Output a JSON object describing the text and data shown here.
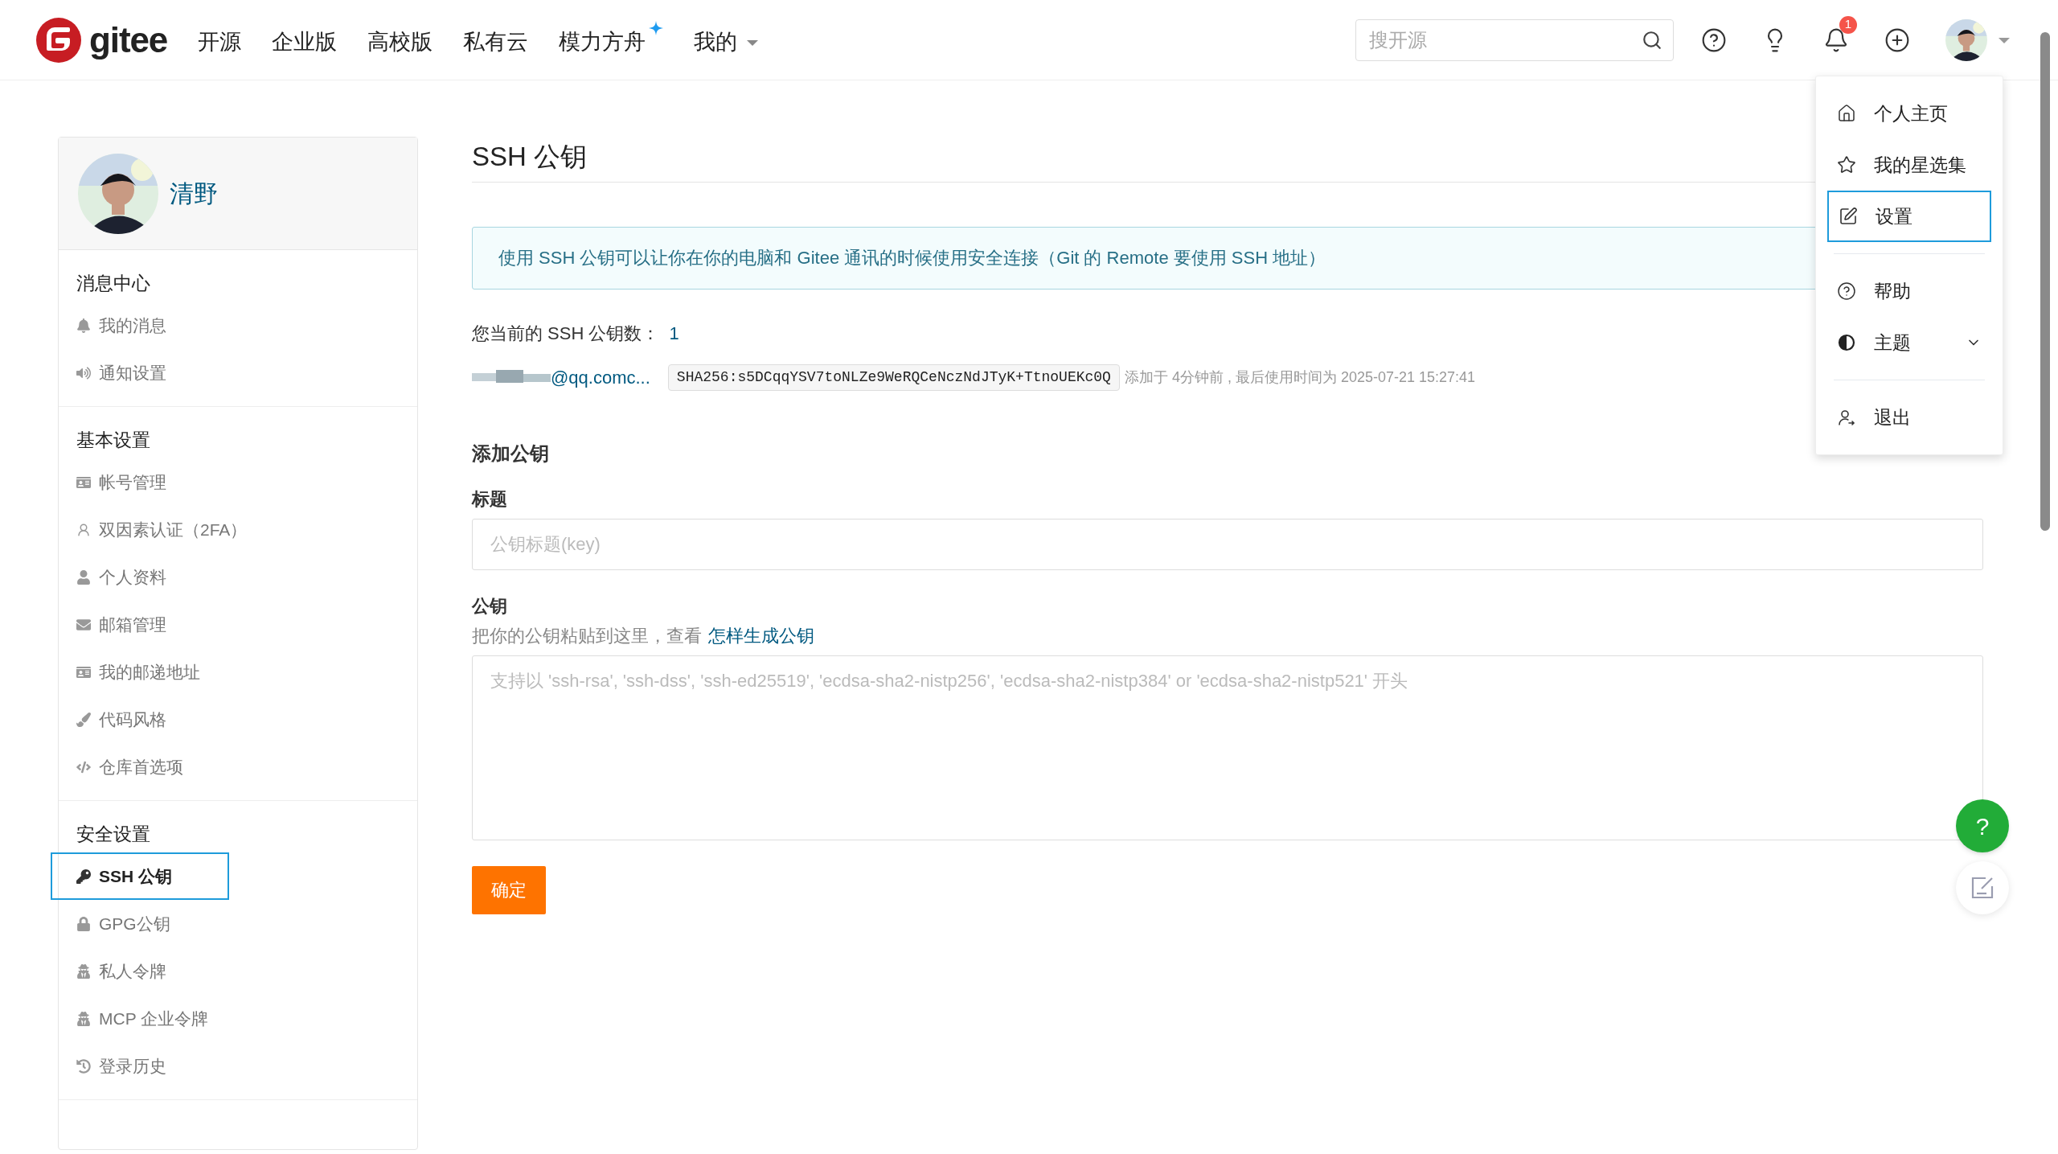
{
  "header": {
    "logo": "gitee",
    "nav": [
      {
        "label": "开源"
      },
      {
        "label": "企业版"
      },
      {
        "label": "高校版"
      },
      {
        "label": "私有云"
      },
      {
        "label": "模力方舟",
        "kind": "sparkle"
      },
      {
        "label": "我的",
        "kind": "menu"
      }
    ],
    "search": {
      "placeholder": "搜开源"
    },
    "notification_count": "1"
  },
  "profile": {
    "name": "清野"
  },
  "sidebar": [
    {
      "title": "消息中心",
      "items": [
        {
          "label": "我的消息",
          "selected": false
        },
        {
          "label": "通知设置",
          "selected": false
        }
      ]
    },
    {
      "title": "基本设置",
      "items": [
        {
          "label": "帐号管理",
          "selected": false
        },
        {
          "label": "双因素认证（2FA）",
          "selected": false
        },
        {
          "label": "个人资料",
          "selected": false
        },
        {
          "label": "邮箱管理",
          "selected": false
        },
        {
          "label": "我的邮递地址",
          "selected": false
        },
        {
          "label": "代码风格",
          "selected": false
        },
        {
          "label": "仓库首选项",
          "selected": false
        }
      ]
    },
    {
      "title": "安全设置",
      "items": [
        {
          "label": "SSH 公钥",
          "selected": true
        },
        {
          "label": "GPG公钥",
          "selected": false
        },
        {
          "label": "私人令牌",
          "selected": false
        },
        {
          "label": "MCP 企业令牌",
          "selected": false
        },
        {
          "label": "登录历史",
          "selected": false
        }
      ]
    }
  ],
  "page": {
    "title": "SSH 公钥",
    "info": "使用 SSH 公钥可以让你在你的电脑和 Gitee 通讯的时候使用安全连接（Git 的 Remote 要使用 SSH 地址）",
    "count_label": "您当前的 SSH 公钥数：",
    "count": "1",
    "keys": [
      {
        "title": "@qq.comc...",
        "fingerprint": "SHA256:s5DCqqYSV7toNLZe9WeRQCeNczNdJTyK+TtnoUEKc0Q",
        "meta": "添加于 4分钟前 , 最后使用时间为 2025-07-21 15:27:41"
      }
    ],
    "form": {
      "heading": "添加公钥",
      "title_label": "标题",
      "title_placeholder": "公钥标题(key)",
      "key_label": "公钥",
      "hint": "把你的公钥粘贴到这里，查看",
      "hint_link": "怎样生成公钥",
      "key_placeholder": "支持以 'ssh-rsa', 'ssh-dss', 'ssh-ed25519', 'ecdsa-sha2-nistp256', 'ecdsa-sha2-nistp384' or 'ecdsa-sha2-nistp521' 开头",
      "submit": "确定"
    }
  },
  "user_menu": [
    {
      "label": "个人主页",
      "selected": false,
      "kind": "home"
    },
    {
      "label": "我的星选集",
      "selected": false,
      "kind": "star"
    },
    {
      "label": "设置",
      "selected": true,
      "kind": "settings"
    },
    {
      "kind": "divider"
    },
    {
      "label": "帮助",
      "selected": false,
      "kind": "help"
    },
    {
      "label": "主题",
      "selected": false,
      "kind": "theme"
    },
    {
      "kind": "divider"
    },
    {
      "label": "退出",
      "selected": false,
      "kind": "logout"
    }
  ],
  "floating_help": "?"
}
